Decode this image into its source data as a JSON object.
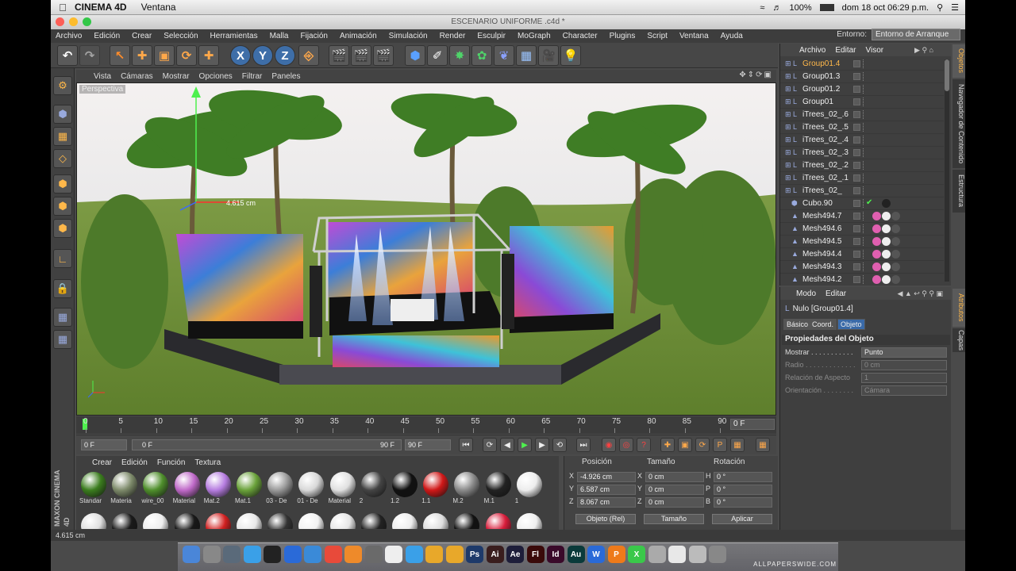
{
  "mac_menubar": {
    "app_name": "CINEMA 4D",
    "menu": "Ventana",
    "battery": "100%",
    "datetime": "dom 18 oct  06:29 p.m."
  },
  "window": {
    "title": "ESCENARIO UNIFORME .c4d *"
  },
  "menubar": {
    "items": [
      "Archivo",
      "Edición",
      "Crear",
      "Selección",
      "Herramientas",
      "Malla",
      "Fijación",
      "Animación",
      "Simulación",
      "Render",
      "Esculpir",
      "MoGraph",
      "Character",
      "Plugins",
      "Script",
      "Ventana",
      "Ayuda"
    ],
    "env_label": "Entorno:",
    "env_value": "Entorno de Arranque"
  },
  "toolbar": {
    "axis_x": "X",
    "axis_y": "Y",
    "axis_z": "Z"
  },
  "viewport": {
    "menu": [
      "Vista",
      "Cámaras",
      "Mostrar",
      "Opciones",
      "Filtrar",
      "Paneles"
    ],
    "camera_label": "Perspectiva",
    "measure_label": "4.615 cm"
  },
  "timeline": {
    "ticks": [
      "0",
      "5",
      "10",
      "15",
      "20",
      "25",
      "30",
      "35",
      "40",
      "45",
      "50",
      "55",
      "60",
      "65",
      "70",
      "75",
      "80",
      "85",
      "90"
    ],
    "current_frame": "0 F"
  },
  "transport": {
    "start": "0 F",
    "slider_start": "0 F",
    "slider_end": "90 F",
    "end": "90 F"
  },
  "materials": {
    "menu": [
      "Crear",
      "Edición",
      "Función",
      "Textura"
    ],
    "row1": [
      {
        "name": "Standar",
        "color": "#3b7d1e"
      },
      {
        "name": "Materia",
        "color": "#7d8a6a"
      },
      {
        "name": "wire_00",
        "color": "#4f8f2c"
      },
      {
        "name": "Material",
        "color": "#c06ac9"
      },
      {
        "name": "Mat.2",
        "color": "#b67de0"
      },
      {
        "name": "Mat.1",
        "color": "#6aa23a"
      },
      {
        "name": "03 - De",
        "color": "#9a9a9a"
      },
      {
        "name": "01 - De",
        "color": "#d8d8d8"
      },
      {
        "name": "Material",
        "color": "#e0e0e0"
      },
      {
        "name": "2",
        "color": "#444444"
      },
      {
        "name": "1.2",
        "color": "#111111"
      },
      {
        "name": "1.1",
        "color": "#d01818"
      },
      {
        "name": "M.2",
        "color": "#8a8a8a"
      },
      {
        "name": "M.1",
        "color": "#222222"
      },
      {
        "name": "1",
        "color": "#ededed"
      }
    ],
    "row2": [
      "#e0e0e0",
      "#1a1a1a",
      "#eeeeee",
      "#181818",
      "#d22020",
      "#e8e8e8",
      "#333333",
      "#f2f2f2",
      "#e6e6e6",
      "#222222",
      "#ededed",
      "#dddddd",
      "#111111",
      "#d81c3a",
      "#efefef"
    ]
  },
  "coords": {
    "hdr_pos": "Posición",
    "hdr_size": "Tamaño",
    "hdr_rot": "Rotación",
    "rows": [
      {
        "axis": "X",
        "pos": "-4.926 cm",
        "saxis": "X",
        "size": "0 cm",
        "raxis": "H",
        "rot": "0 °"
      },
      {
        "axis": "Y",
        "pos": "6.587 cm",
        "saxis": "Y",
        "size": "0 cm",
        "raxis": "P",
        "rot": "0 °"
      },
      {
        "axis": "Z",
        "pos": "8.067 cm",
        "saxis": "Z",
        "size": "0 cm",
        "raxis": "B",
        "rot": "0 °"
      }
    ],
    "mode": "Objeto (Rel)",
    "size_mode": "Tamaño",
    "apply": "Aplicar"
  },
  "objects": {
    "menu": [
      "Archivo",
      "Editar",
      "Visor"
    ],
    "rows": [
      "Group01.4",
      "Group01.3",
      "Group01.2",
      "Group01",
      "iTrees_02_.6",
      "iTrees_02_.5",
      "iTrees_02_.4",
      "iTrees_02_.3",
      "iTrees_02_.2",
      "iTrees_02_.1",
      "iTrees_02_",
      "Cubo.90",
      "Mesh494.7",
      "Mesh494.6",
      "Mesh494.5",
      "Mesh494.4",
      "Mesh494.3",
      "Mesh494.2"
    ]
  },
  "side_tabs": {
    "objetos": "Objetos",
    "navegador": "Navegador de Contenido",
    "estructura": "Estructura",
    "atributos": "Atributos",
    "capas": "Capas"
  },
  "attributes": {
    "menu": [
      "Modo",
      "Editar"
    ],
    "object": "Nulo [Group01.4]",
    "tabs": [
      "Básico",
      "Coord.",
      "Objeto"
    ],
    "section": "Propiedades del Objeto",
    "rows": [
      {
        "label": "Mostrar . . . . . . . . . . .",
        "value": "Punto"
      },
      {
        "label": "Radio . . . . . . . . . . . . .",
        "value": "0 cm"
      },
      {
        "label": "Relación de Aspecto",
        "value": "1"
      },
      {
        "label": "Orientación . . . . . . . .",
        "value": "Cámara"
      }
    ]
  },
  "status": {
    "text": "4.615 cm"
  },
  "watermark": "ALLPAPERSWIDE.COM"
}
